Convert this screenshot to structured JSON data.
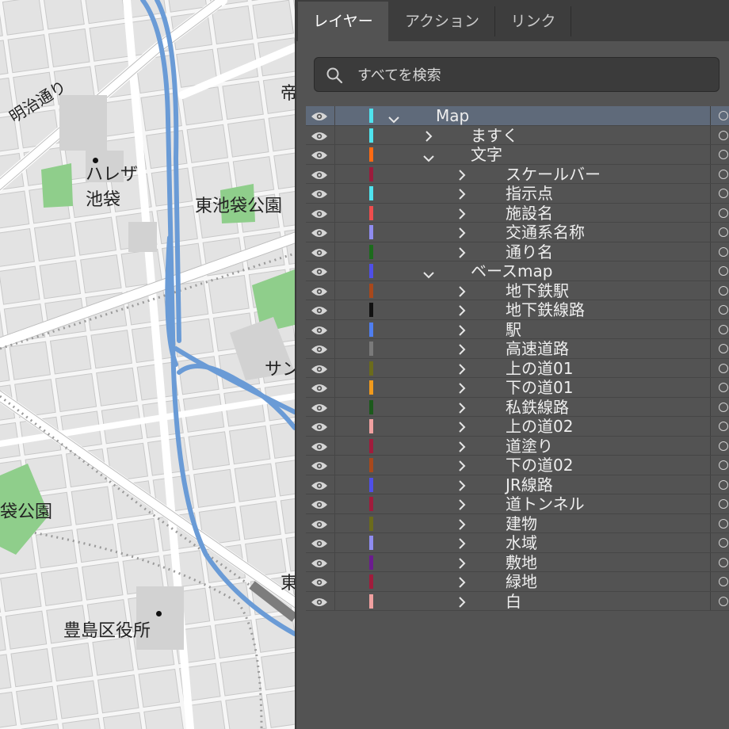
{
  "tabs": [
    {
      "label": "レイヤー",
      "active": true
    },
    {
      "label": "アクション",
      "active": false
    },
    {
      "label": "リンク",
      "active": false
    }
  ],
  "search": {
    "placeholder": "すべてを検索",
    "value": ""
  },
  "icons": {
    "visibility": "eye-icon",
    "search": "search-icon",
    "expand": "chevron-right-icon",
    "collapse": "chevron-down-icon",
    "target": "target-circle-icon"
  },
  "layers": [
    {
      "name": "Map",
      "depth": 0,
      "expanded": true,
      "selected": true,
      "color": "#4fe3ee"
    },
    {
      "name": "ますく",
      "depth": 1,
      "expanded": false,
      "color": "#4fe3ee"
    },
    {
      "name": "文字",
      "depth": 1,
      "expanded": true,
      "color": "#ff6a13"
    },
    {
      "name": "スケールバー",
      "depth": 2,
      "expanded": false,
      "color": "#9a1c3c"
    },
    {
      "name": "指示点",
      "depth": 2,
      "expanded": false,
      "color": "#4fe3ee"
    },
    {
      "name": "施設名",
      "depth": 2,
      "expanded": false,
      "color": "#ee4d4d"
    },
    {
      "name": "交通系名称",
      "depth": 2,
      "expanded": false,
      "color": "#8f8cf0"
    },
    {
      "name": "通り名",
      "depth": 2,
      "expanded": false,
      "color": "#1c6b1c"
    },
    {
      "name": "ベースmap",
      "depth": 1,
      "expanded": true,
      "color": "#4f4fe8"
    },
    {
      "name": "地下鉄駅",
      "depth": 2,
      "expanded": false,
      "color": "#a8481c"
    },
    {
      "name": "地下鉄線路",
      "depth": 2,
      "expanded": false,
      "color": "#111111"
    },
    {
      "name": "駅",
      "depth": 2,
      "expanded": false,
      "color": "#4f7ef0"
    },
    {
      "name": "高速道路",
      "depth": 2,
      "expanded": false,
      "color": "#7a7a7a"
    },
    {
      "name": "上の道01",
      "depth": 2,
      "expanded": false,
      "color": "#6b6b1c"
    },
    {
      "name": "下の道01",
      "depth": 2,
      "expanded": false,
      "color": "#f09a1c"
    },
    {
      "name": "私鉄線路",
      "depth": 2,
      "expanded": false,
      "color": "#1c5a1c"
    },
    {
      "name": "上の道02",
      "depth": 2,
      "expanded": false,
      "color": "#f0a0a0"
    },
    {
      "name": "道塗り",
      "depth": 2,
      "expanded": false,
      "color": "#a01c3c"
    },
    {
      "name": "下の道02",
      "depth": 2,
      "expanded": false,
      "color": "#a8481c"
    },
    {
      "name": "JR線路",
      "depth": 2,
      "expanded": false,
      "color": "#4f4fe8"
    },
    {
      "name": "道トンネル",
      "depth": 2,
      "expanded": false,
      "color": "#a01c3c"
    },
    {
      "name": "建物",
      "depth": 2,
      "expanded": false,
      "color": "#6b6b1c"
    },
    {
      "name": "水域",
      "depth": 2,
      "expanded": false,
      "color": "#8f8cf0"
    },
    {
      "name": "敷地",
      "depth": 2,
      "expanded": false,
      "color": "#6b1c8f"
    },
    {
      "name": "緑地",
      "depth": 2,
      "expanded": false,
      "color": "#a01c3c"
    },
    {
      "name": "白",
      "depth": 2,
      "expanded": false,
      "color": "#f0a0a0"
    }
  ],
  "map": {
    "labels": {
      "meiji_dori": "明治通り",
      "halle_za_1": "ハレザ",
      "halle_za_2": "池袋",
      "higashi_park": "東池袋公園",
      "park_left": "袋公園",
      "sun_partial": "サン",
      "ward_office": "豊島区役所",
      "top_right_partial": "帝",
      "bottom_right_partial": "東"
    },
    "colors": {
      "background": "#eeeeee",
      "block": "#e1e1e1",
      "road": "#ffffff",
      "highway": "#6a9bd6",
      "park": "#8fce8b",
      "building": "#d2d2d2"
    }
  }
}
